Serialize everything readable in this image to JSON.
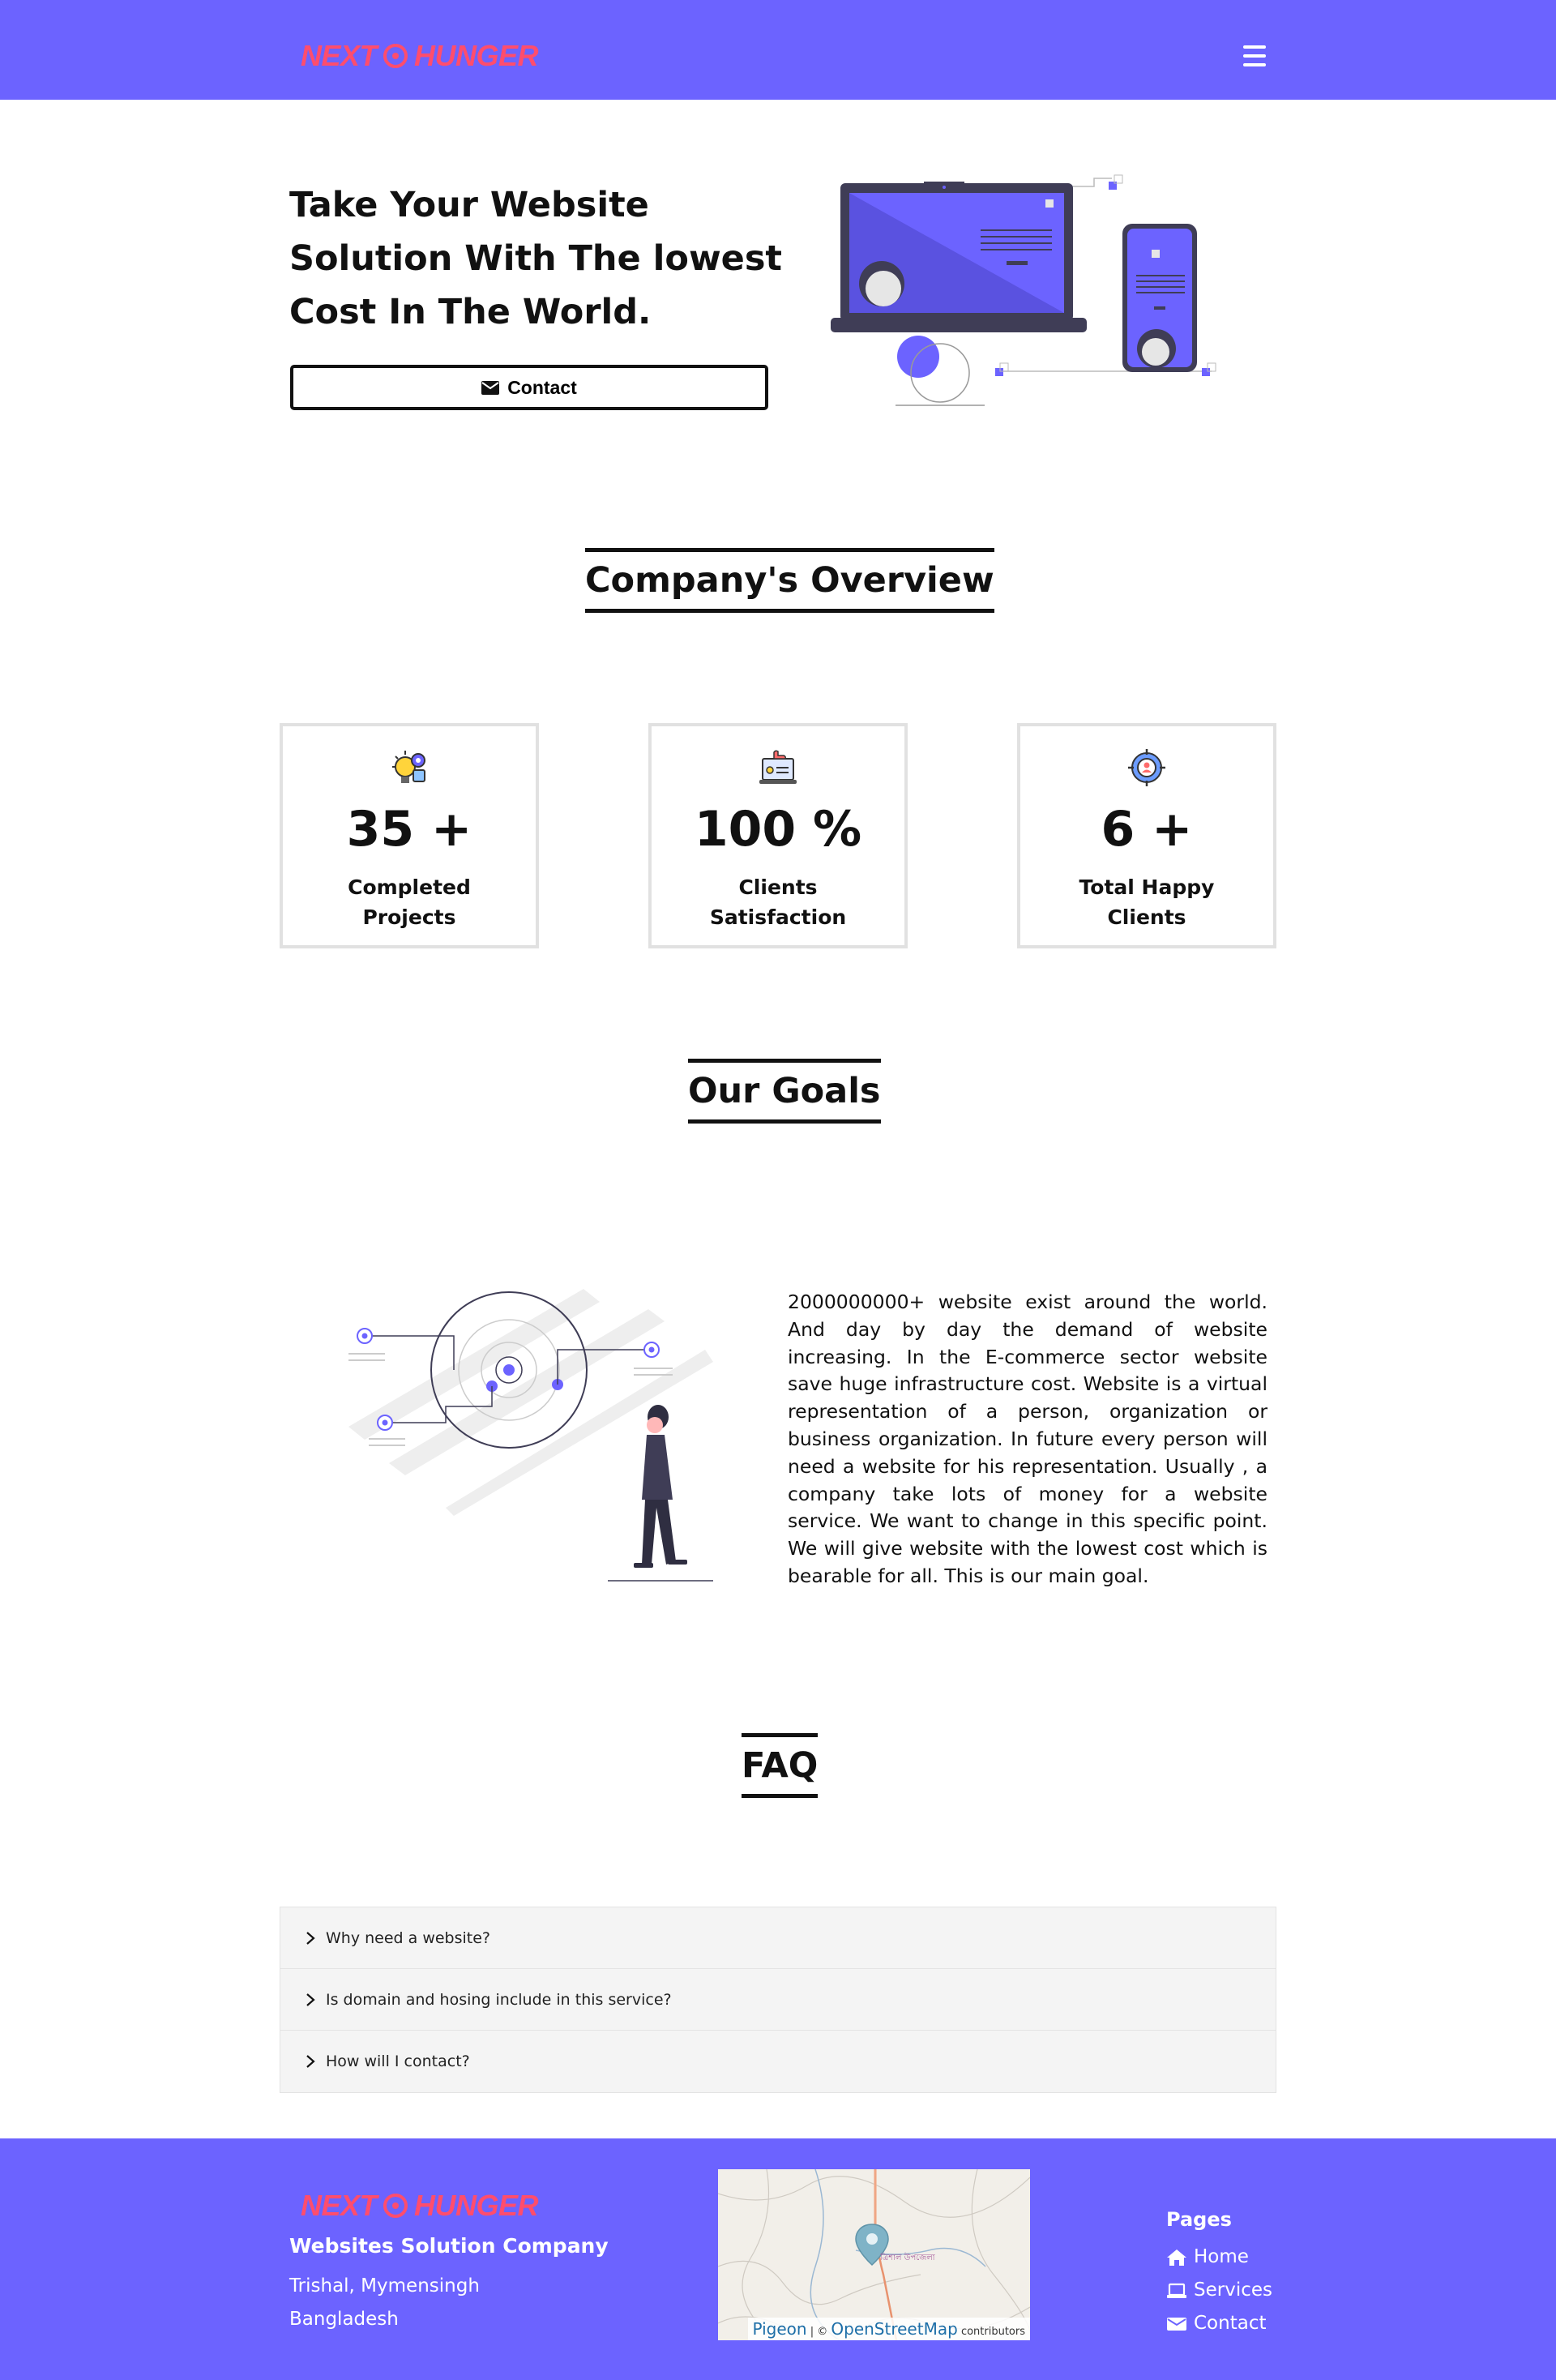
{
  "brand": {
    "logo_left": "NEXT",
    "logo_right": "HUNGER",
    "accent": "#6c63ff",
    "logo_color": "#ff4d6d"
  },
  "hero": {
    "title_lines": [
      "Take Your Website",
      "Solution With The lowest",
      "Cost In The World."
    ],
    "contact_label": "Contact",
    "contact_icon": "envelope-icon"
  },
  "overview": {
    "title": "Company's Overview",
    "cards": [
      {
        "icon": "lightbulb-gear-icon",
        "stat": "35 +",
        "label": "Completed Projects"
      },
      {
        "icon": "thumbs-up-laptop-icon",
        "stat": "100 %",
        "label": "Clients Satisfaction"
      },
      {
        "icon": "target-user-icon",
        "stat": "6 +",
        "label": "Total Happy Clients"
      }
    ]
  },
  "goals": {
    "title": "Our Goals",
    "text": "2000000000+ website exist around the world. And day by day the demand of website increasing. In the E-commerce sector website save huge infrastructure cost. Website is a virtual representation of a person, organization or business organization. In future every person will need a website for his representation. Usually , a company take lots of money for a website service. We want to change in this specific point. We will give website with the lowest cost which is bearable for all. This is our main goal."
  },
  "faq": {
    "title": "FAQ",
    "items": [
      "Why need a website?",
      "Is domain and hosing include in this service?",
      "How will I contact?"
    ]
  },
  "footer": {
    "company": "Websites Solution Company",
    "address_lines": [
      "Trishal, Mymensingh",
      "Bangladesh"
    ],
    "map": {
      "attribution_main": "Pigeon",
      "attribution_sep": "| ©",
      "attribution_osm": "OpenStreetMap",
      "attribution_tail": "contributors",
      "place_label": "ত্রিশাল উপজেলা"
    },
    "pages_title": "Pages",
    "pages": [
      {
        "label": "Home",
        "icon": "home-icon"
      },
      {
        "label": "Services",
        "icon": "laptop-icon"
      },
      {
        "label": "Contact",
        "icon": "envelope-icon"
      }
    ]
  }
}
